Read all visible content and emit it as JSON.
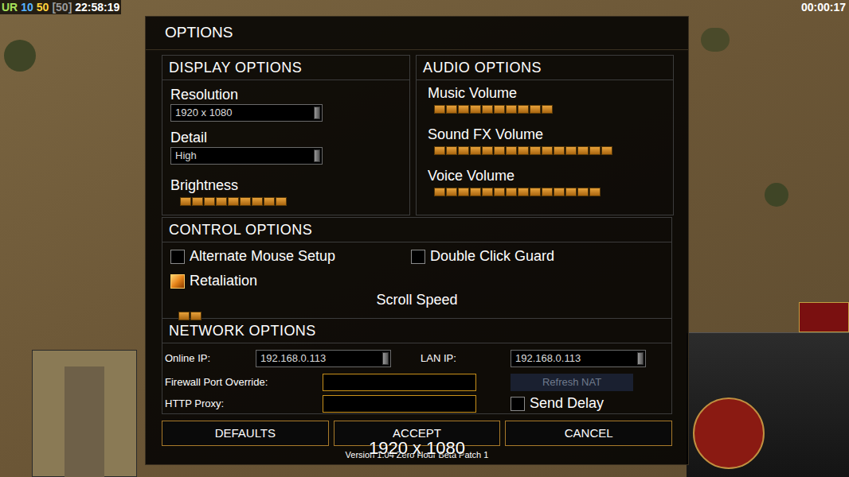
{
  "hud": {
    "stats": [
      {
        "text": "UR",
        "color": "#a8e05a"
      },
      {
        "text": "10",
        "color": "#58b4ff"
      },
      {
        "text": "50",
        "color": "#ffd23c"
      },
      {
        "text": "[50]",
        "color": "#9a9a9a"
      },
      {
        "text": "22:58:19",
        "color": "#ffffff"
      }
    ],
    "timer": "00:00:17",
    "overlay": "1920 x 1080"
  },
  "dialog": {
    "title": "OPTIONS",
    "display": {
      "title": "DISPLAY OPTIONS",
      "resolution": {
        "label": "Resolution",
        "value": "1920 x 1080"
      },
      "detail": {
        "label": "Detail",
        "value": "High"
      },
      "brightness": {
        "label": "Brightness",
        "level": 0.45
      }
    },
    "audio": {
      "title": "AUDIO OPTIONS",
      "sliders": [
        {
          "label": "Music Volume",
          "level": 0.5
        },
        {
          "label": "Sound FX Volume",
          "level": 0.75
        },
        {
          "label": "Voice Volume",
          "level": 0.7
        }
      ]
    },
    "control": {
      "title": "CONTROL OPTIONS",
      "checkboxes": [
        {
          "label": "Alternate Mouse Setup",
          "checked": false
        },
        {
          "label": "Double Click Guard",
          "checked": false
        },
        {
          "label": "Retaliation",
          "checked": true
        }
      ],
      "scroll_speed": {
        "label": "Scroll Speed",
        "level": 0.1
      }
    },
    "network": {
      "title": "NETWORK OPTIONS",
      "online_ip": {
        "label": "Online IP:",
        "value": "192.168.0.113"
      },
      "lan_ip": {
        "label": "LAN IP:",
        "value": "192.168.0.113"
      },
      "firewall_port": {
        "label": "Firewall Port Override:",
        "value": ""
      },
      "http_proxy": {
        "label": "HTTP Proxy:",
        "value": ""
      },
      "refresh_nat": {
        "label": "Refresh NAT",
        "disabled": true
      },
      "send_delay": {
        "label": "Send Delay",
        "checked": false
      }
    },
    "buttons": [
      "DEFAULTS",
      "ACCEPT",
      "CANCEL"
    ],
    "version": "Version 1.04 Zero Hour Beta Patch 1"
  }
}
